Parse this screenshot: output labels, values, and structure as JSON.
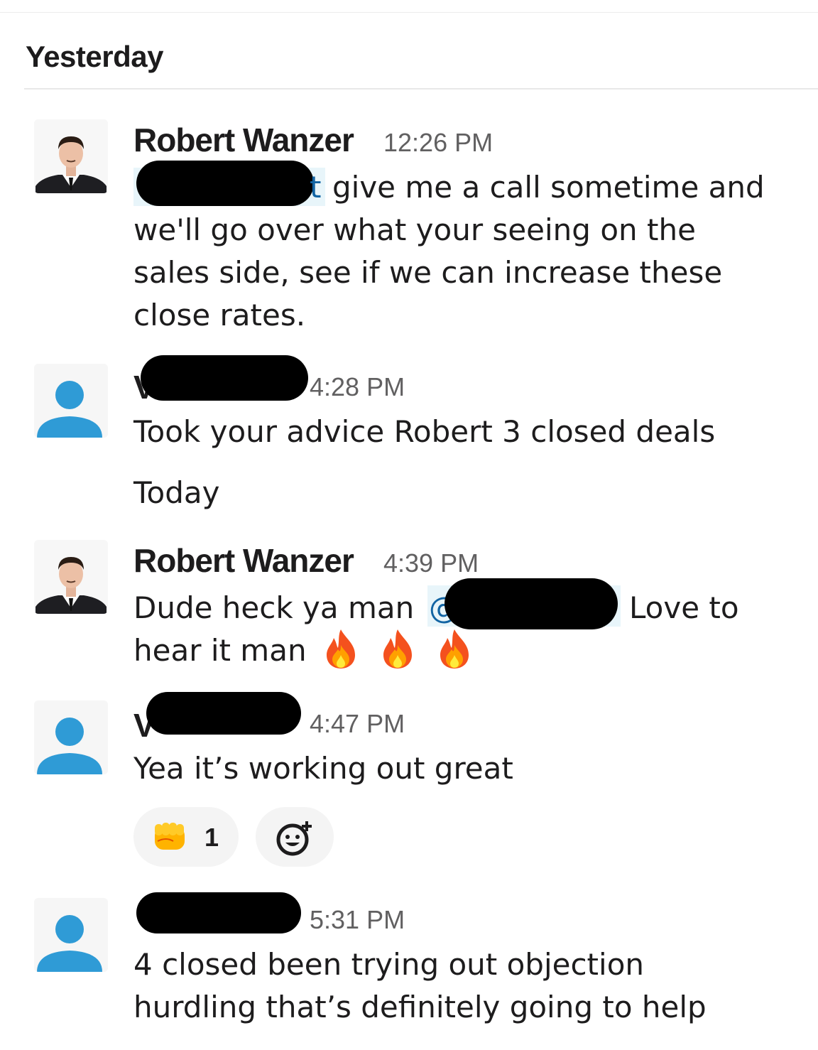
{
  "dividers": {
    "yesterday": "Yesterday",
    "today": "Today"
  },
  "messages": [
    {
      "sender": "Robert Wanzer",
      "time": "12:26 PM",
      "lines": [
        "give me a call sometime and",
        "we'll go over what your seeing on the",
        "sales side, see if we can increase these",
        "close rates."
      ]
    },
    {
      "sender": "",
      "time": "4:28 PM",
      "lines": [
        "Took your advice Robert 3 closed deals"
      ]
    },
    {
      "sender": "Robert Wanzer",
      "time": "4:39 PM",
      "lines": [
        "Dude heck ya man",
        "Love to",
        "hear it man"
      ]
    },
    {
      "sender": "",
      "time": "4:47 PM",
      "lines": [
        "Yea it’s working out great"
      ],
      "reactions": [
        {
          "emoji": "fist-bump",
          "count": "1"
        }
      ]
    },
    {
      "sender": "",
      "time": "5:31 PM",
      "lines": [
        "4 closed been trying out objection",
        "hurdling that’s definitely going to help"
      ]
    }
  ],
  "colors": {
    "mention_text": "#1264a3",
    "mention_bg": "#e8f5fa",
    "default_avatar": "#2f9bd6"
  }
}
